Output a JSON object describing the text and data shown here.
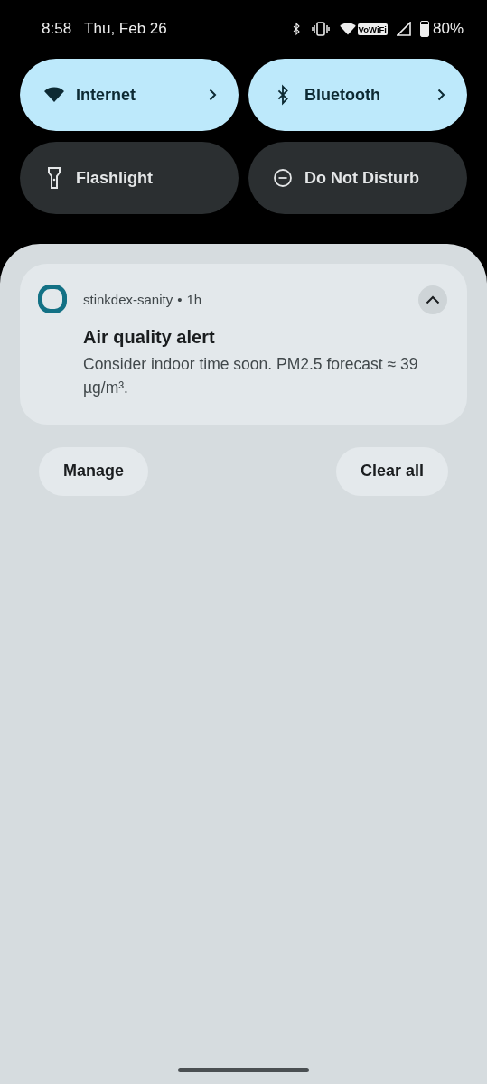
{
  "status_bar": {
    "time": "8:58",
    "date": "Thu, Feb 26",
    "vowifi": "VoWiFi",
    "battery": "80%"
  },
  "tiles": [
    {
      "label": "Internet",
      "on": true
    },
    {
      "label": "Bluetooth",
      "on": true
    },
    {
      "label": "Flashlight",
      "on": false
    },
    {
      "label": "Do Not Disturb",
      "on": false
    }
  ],
  "notification": {
    "app": "stinkdex-sanity",
    "separator": "•",
    "time": "1h",
    "expanded": true,
    "title": "Air quality alert",
    "body": "Consider indoor time soon. PM2.5 forecast ≈ 39 µg/m³."
  },
  "buttons": [
    "Manage",
    "Clear all"
  ]
}
